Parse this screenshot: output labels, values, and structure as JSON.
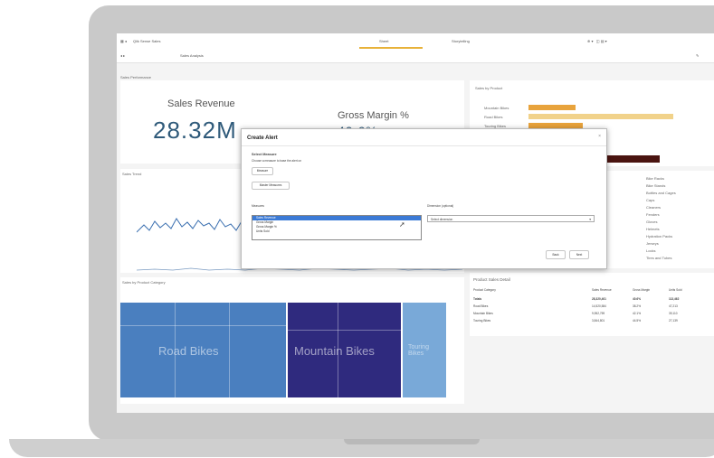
{
  "app": {
    "title": "Qlik Sense Sales",
    "nav_tabs": [
      "Sheet",
      "Storytelling"
    ],
    "sheet_tab": "Sales Analysis",
    "sheet_subtitle": "Sales Performance"
  },
  "kpis": {
    "sales_revenue_label": "Sales Revenue",
    "sales_revenue_value": "28.32M",
    "gross_margin_label": "Gross Margin %",
    "gross_margin_value": "40.6%"
  },
  "sales_by_product": {
    "title": "Sales by Product",
    "rows": [
      "Mountain Bikes",
      "Road Bikes",
      "Touring Bikes",
      "Accessories"
    ]
  },
  "sales_trend": {
    "title": "Sales Trend"
  },
  "treemap": {
    "title": "Sales by Product Category",
    "labels": {
      "road": "Road Bikes",
      "mountain": "Mountain Bikes",
      "touring": "Touring Bikes"
    }
  },
  "product_list": [
    "Bike Racks",
    "Bike Stands",
    "Bottles and Cages",
    "Caps",
    "Cleaners",
    "Fenders",
    "Gloves",
    "Helmets",
    "Hydration Packs",
    "Jerseys",
    "Locks",
    "Tires and Tubes"
  ],
  "product_detail_table": {
    "title": "Product Sales Detail",
    "headers": [
      "Product Category",
      "Sales Revenue",
      "Gross Margin",
      "Units Sold"
    ],
    "rows": [
      [
        "Totals",
        "28,320,401",
        "40.6%",
        "113,462"
      ],
      [
        "Road Bikes",
        "14,520,584",
        "38.2%",
        "47,213"
      ],
      [
        "Mountain Bikes",
        "9,952,759",
        "42.1%",
        "39,110"
      ],
      [
        "Touring Bikes",
        "3,844,801",
        "44.5%",
        "27,139"
      ]
    ]
  },
  "modal": {
    "title": "Create Alert",
    "close": "×",
    "section": "Select Measure",
    "hint": "Choose a measure to base the alert on",
    "btn_measure": "Measure",
    "btn_master": "Master Measures",
    "list_label": "Measures",
    "options": [
      "Sales Revenue",
      "Gross Margin",
      "Gross Margin %",
      "Units Sold"
    ],
    "dimension_label": "Dimension (optional)",
    "dimension_placeholder": "Select dimension",
    "back": "Back",
    "next": "Next"
  },
  "colors": {
    "treemap_road": "#4a7fbf",
    "treemap_mountain": "#2f2a7e",
    "treemap_touring": "#79a9d8",
    "bar_accent": "#e8a33c",
    "accent_dark": "#4a1410"
  }
}
